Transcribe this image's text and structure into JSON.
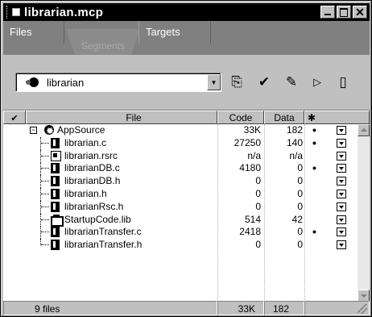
{
  "window": {
    "title": "librarian.mcp",
    "buttons": [
      "minimize",
      "maximize",
      "close"
    ],
    "close_glyph": "✕"
  },
  "tabs": [
    {
      "label": "Files",
      "active": true
    },
    {
      "label": "Segments",
      "active": false
    },
    {
      "label": "Targets",
      "active": false
    }
  ],
  "toolbar": {
    "target_value": "librarian",
    "tools": [
      {
        "name": "synchronize-icon",
        "glyph": "⎘"
      },
      {
        "name": "check-syntax-icon",
        "glyph": "✔"
      },
      {
        "name": "make-icon",
        "glyph": "✎"
      },
      {
        "name": "run-icon",
        "glyph": "▷"
      },
      {
        "name": "debug-icon",
        "glyph": "▯"
      }
    ]
  },
  "columns": {
    "check": "✔",
    "file": "File",
    "code": "Code",
    "data": "Data",
    "debug": "✱"
  },
  "rows": [
    {
      "type": "group",
      "name": "AppSource",
      "code": "33K",
      "data": "182",
      "debug": true
    },
    {
      "type": "source",
      "name": "librarian.c",
      "code": "27250",
      "data": "140",
      "debug": true
    },
    {
      "type": "resource",
      "name": "librarian.rsrc",
      "code": "n/a",
      "data": "n/a",
      "debug": false
    },
    {
      "type": "source",
      "name": "librarianDB.c",
      "code": "4180",
      "data": "0",
      "debug": true
    },
    {
      "type": "source",
      "name": "librarianDB.h",
      "code": "0",
      "data": "0",
      "debug": false
    },
    {
      "type": "source",
      "name": "librarian.h",
      "code": "0",
      "data": "0",
      "debug": false
    },
    {
      "type": "source",
      "name": "librarianRsc.h",
      "code": "0",
      "data": "0",
      "debug": false
    },
    {
      "type": "library",
      "name": "StartupCode.lib",
      "code": "514",
      "data": "42",
      "debug": false
    },
    {
      "type": "source",
      "name": "librarianTransfer.c",
      "code": "2418",
      "data": "0",
      "debug": true
    },
    {
      "type": "source",
      "name": "librarianTransfer.h",
      "code": "0",
      "data": "0",
      "debug": false
    }
  ],
  "debug_marker": "•",
  "status": {
    "files": "9 files",
    "code": "33K",
    "data": "182"
  }
}
